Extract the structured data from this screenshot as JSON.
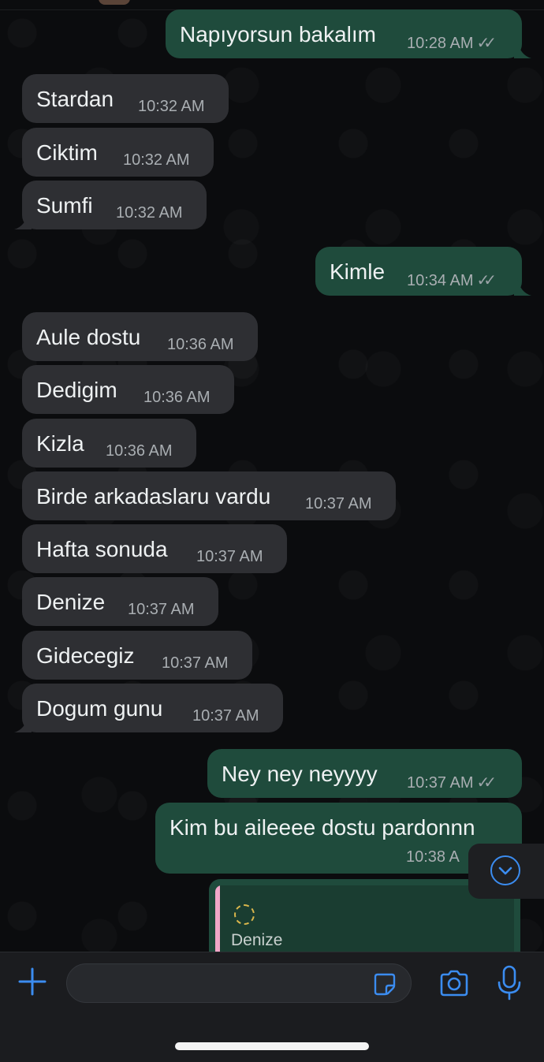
{
  "messages": [
    {
      "dir": "out",
      "text": "Napıyorsun bakalım",
      "time": "10:28 AM",
      "read": true
    },
    {
      "dir": "in",
      "text": "Stardan",
      "time": "10:32 AM"
    },
    {
      "dir": "in",
      "text": "Ciktim",
      "time": "10:32 AM"
    },
    {
      "dir": "in",
      "text": "Sumfi",
      "time": "10:32 AM"
    },
    {
      "dir": "out",
      "text": "Kimle",
      "time": "10:34 AM",
      "read": true
    },
    {
      "dir": "in",
      "text": "Aule dostu",
      "time": "10:36 AM"
    },
    {
      "dir": "in",
      "text": "Dedigim",
      "time": "10:36 AM"
    },
    {
      "dir": "in",
      "text": "Kizla",
      "time": "10:36 AM"
    },
    {
      "dir": "in",
      "text": "Birde arkadaslaru vardu",
      "time": "10:37 AM"
    },
    {
      "dir": "in",
      "text": "Hafta sonuda",
      "time": "10:37 AM"
    },
    {
      "dir": "in",
      "text": "Denize",
      "time": "10:37 AM"
    },
    {
      "dir": "in",
      "text": "Gidecegiz",
      "time": "10:37 AM"
    },
    {
      "dir": "in",
      "text": "Dogum gunu",
      "time": "10:37 AM"
    },
    {
      "dir": "out",
      "text": "Ney ney neyyyy",
      "time": "10:37 AM",
      "read": true
    },
    {
      "dir": "out",
      "text": "Kim bu aileeee dostu pardonnn",
      "time": "10:38 A"
    }
  ],
  "quoted_reply": {
    "text": "Denize",
    "icon": "sticker-emoji-icon"
  },
  "ticks_glyph": "✓✓",
  "colors": {
    "incoming": "#2e2f33",
    "outgoing": "#1f4b3c",
    "accent": "#3b8cf0",
    "background": "#0b0c0e"
  },
  "composer": {
    "icons": [
      "plus-icon",
      "sticker-icon",
      "camera-icon",
      "microphone-icon"
    ]
  }
}
